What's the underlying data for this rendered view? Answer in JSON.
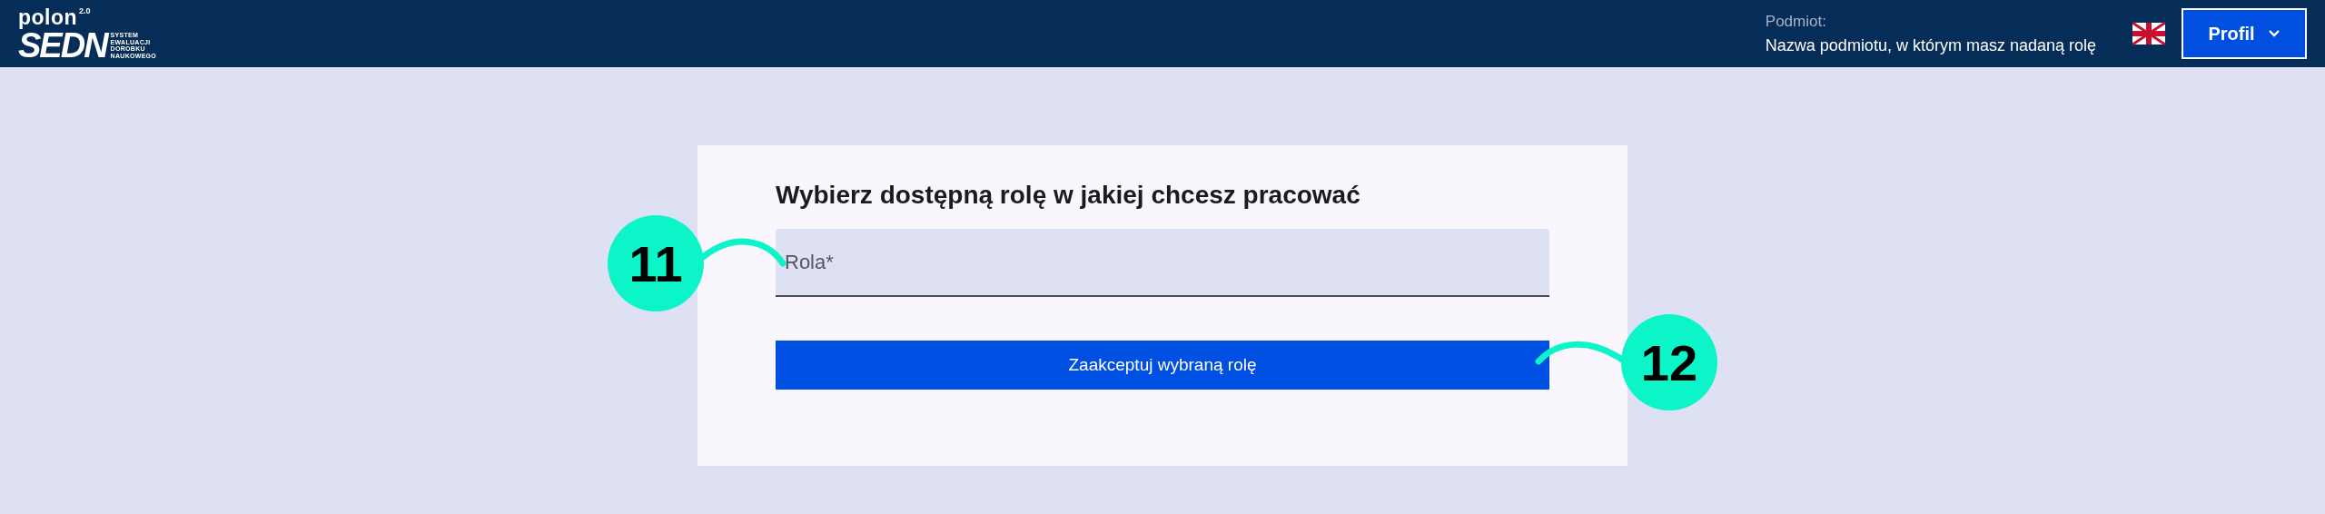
{
  "header": {
    "logo": {
      "name": "polon",
      "version": "2.0",
      "mark": "SEDN",
      "tagline": [
        "SYSTEM",
        "EWALUACJI",
        "DOROBKU",
        "NAUKOWEGO"
      ]
    },
    "entity_label": "Podmiot:",
    "entity_name": "Nazwa podmiotu, w którym masz nadaną rolę",
    "profile_button": "Profil"
  },
  "card": {
    "title": "Wybierz dostępną rolę w jakiej chcesz pracować",
    "field": {
      "placeholder": "Rola*"
    },
    "button": "Zaakceptuj wybraną rolę"
  },
  "callouts": [
    {
      "number": "11",
      "kind": "field"
    },
    {
      "number": "12",
      "kind": "button"
    }
  ]
}
